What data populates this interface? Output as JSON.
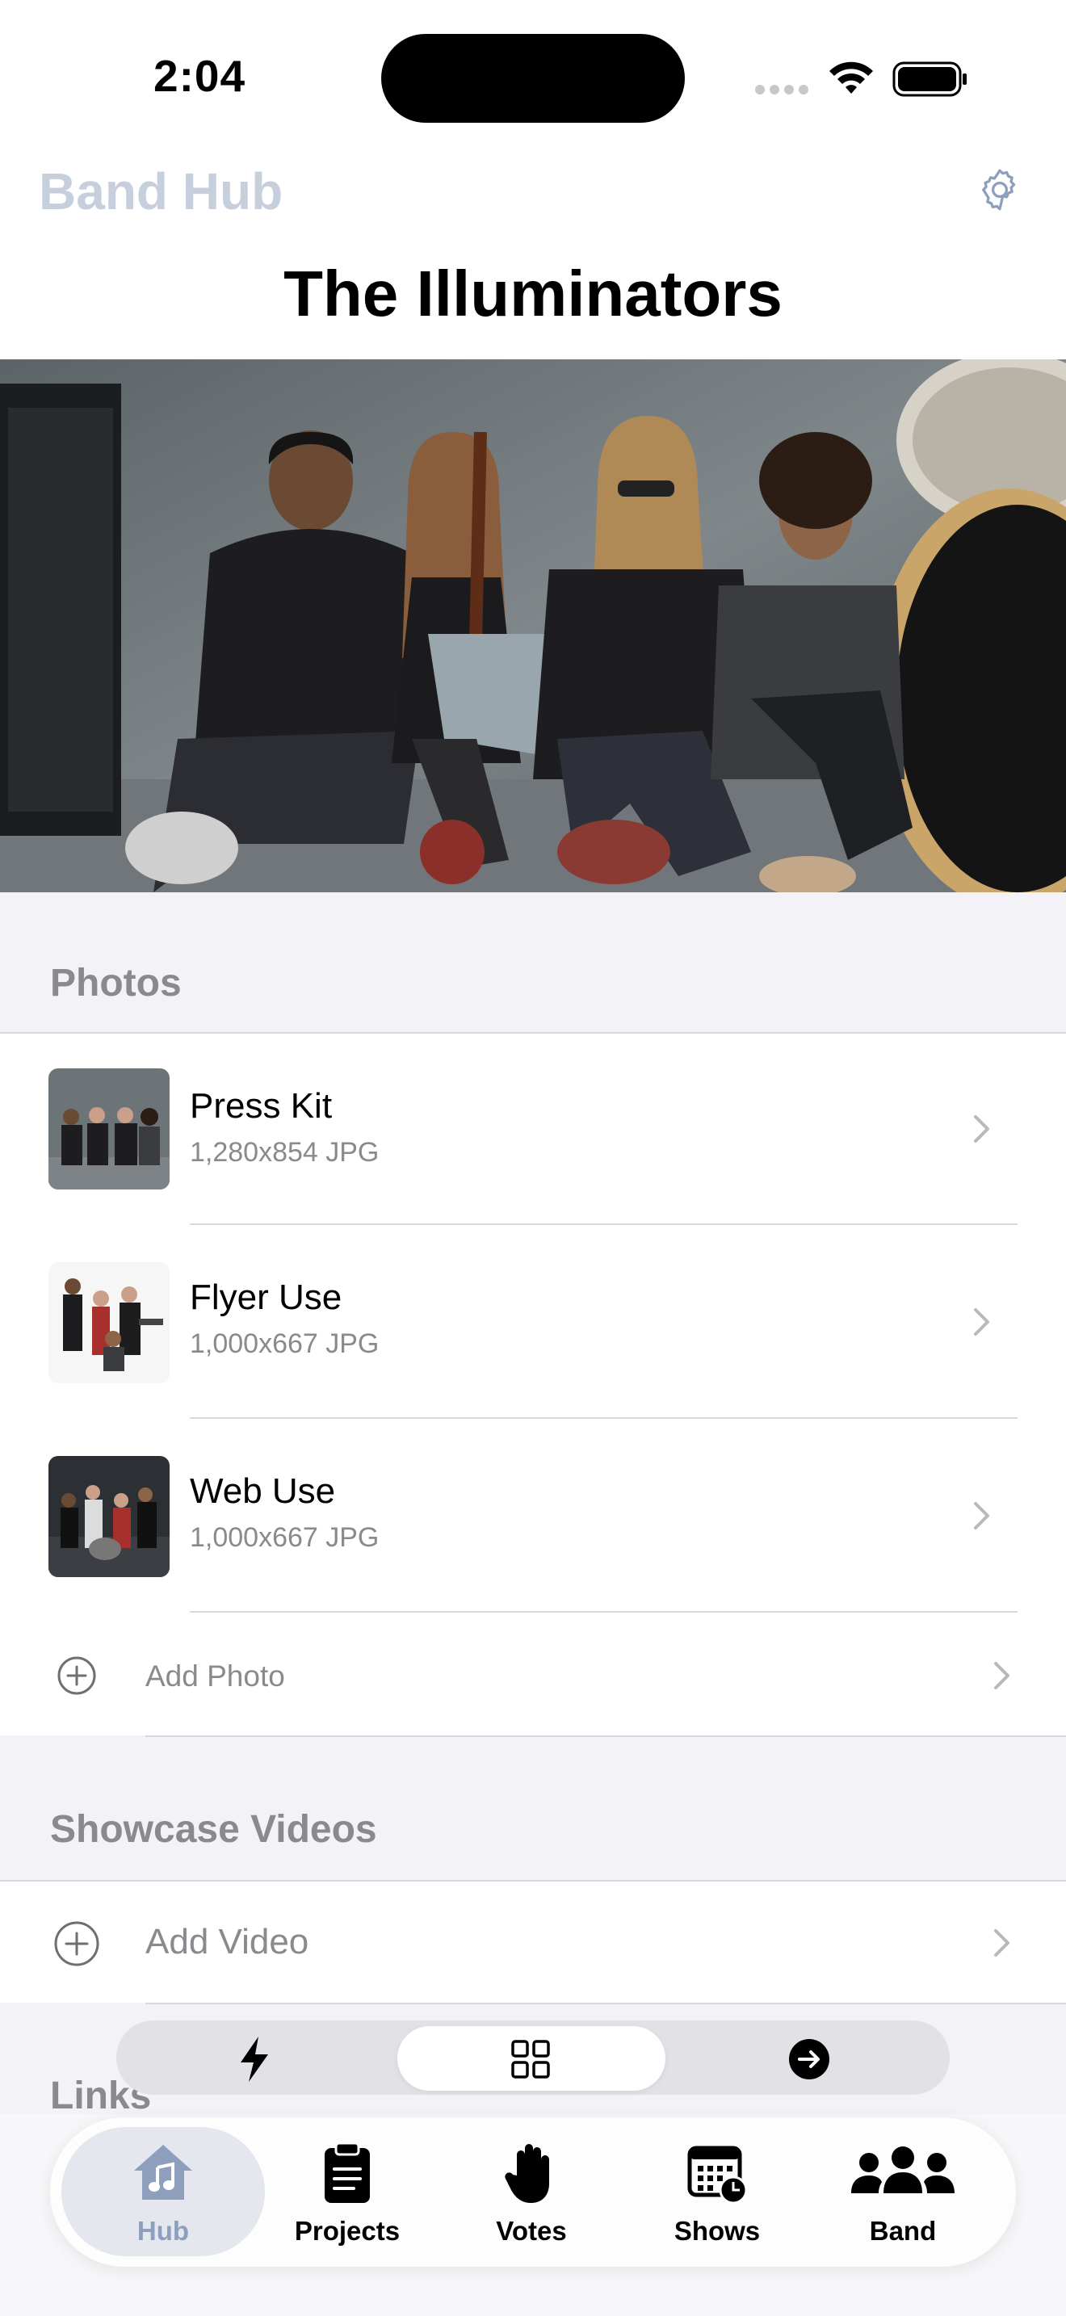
{
  "status_bar": {
    "time": "2:04"
  },
  "header": {
    "app_name": "Band Hub",
    "band_name": "The Illuminators"
  },
  "photos_section": {
    "title": "Photos",
    "items": [
      {
        "title": "Press Kit",
        "subtitle": "1,280x854 JPG"
      },
      {
        "title": "Flyer Use",
        "subtitle": "1,000x667 JPG"
      },
      {
        "title": "Web Use",
        "subtitle": "1,000x667 JPG"
      }
    ],
    "add_label": "Add Photo"
  },
  "videos_section": {
    "title": "Showcase Videos",
    "add_label": "Add Video"
  },
  "links_section": {
    "title": "Links"
  },
  "segmented_control": {
    "segments": [
      "bolt-icon",
      "grid-icon",
      "arrow-right-circle-icon"
    ],
    "selected_index": 1
  },
  "tab_bar": {
    "tabs": [
      {
        "label": "Hub",
        "icon": "house-music-icon",
        "selected": true
      },
      {
        "label": "Projects",
        "icon": "clipboard-icon"
      },
      {
        "label": "Votes",
        "icon": "hand-icon"
      },
      {
        "label": "Shows",
        "icon": "calendar-clock-icon"
      },
      {
        "label": "Band",
        "icon": "people-icon"
      }
    ]
  },
  "colors": {
    "accent": "#8e9fbd",
    "app_name": "#c6cfdb",
    "secondary_text": "#8a8a8e",
    "grouped_background": "#f2f2f7"
  }
}
